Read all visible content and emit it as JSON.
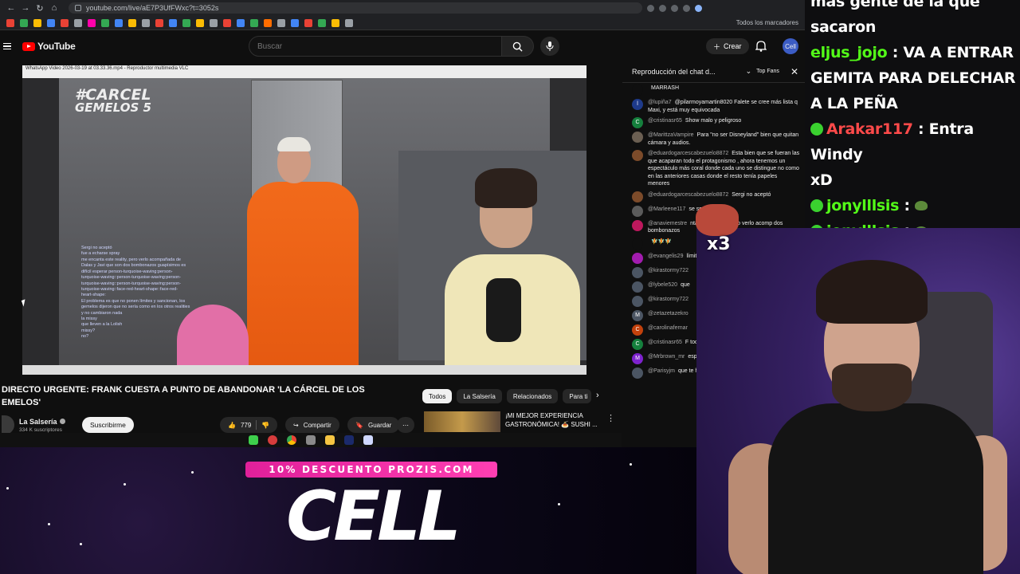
{
  "browser": {
    "url": "youtube.com/live/aE7P3UfFWxc?t=3052s",
    "bookmarks_label": "Todos los marcadores"
  },
  "header": {
    "logo_text": "YouTube",
    "search_placeholder": "Buscar",
    "create_label": "Crear",
    "avatar_text": "Cell"
  },
  "video": {
    "overlay_logo_line1": "#CARCEL",
    "overlay_logo_line2": "GEMELOS 5",
    "vlc_title": "WhatsApp Video 2026-03-19 at 03.33.36.mp4 - Reproductor multimedia VLC",
    "overlay_chat": [
      "Sergi no aceptó",
      "fue a echarse spray",
      "me encanta este reality, pero verlo acompañada de",
      "Dalas y Javi que son dos bombonazos guapísimos es",
      "difícil esperar person-turquoise-waving:person-",
      "turquoise-waving::person-turquoise-waving:person-",
      "turquoise-waving::person-turquoise-waving:person-",
      "turquoise-waving::face-red-heart-shape::face-red-",
      "heart-shape:",
      "El problema es que no ponen límites y sancionan, los",
      "gemelos dijeron que no sería como en los otros realities",
      "y no cambiaron nada",
      "la missy",
      "que lleven a la Lolish",
      "missy?",
      "no?"
    ]
  },
  "below": {
    "title": "DIRECTO URGENTE: FRANK CUESTA A PUNTO DE ABANDONAR 'LA CÁRCEL DE LOS EMELOS'",
    "channel_name": "La Salsería",
    "subscribers": "334 K suscriptores",
    "subscribe_label": "Suscribirme",
    "like_count": "779",
    "share_label": "Compartir",
    "save_label": "Guardar",
    "chips": [
      "Todos",
      "La Salsería",
      "Relacionados",
      "Para ti"
    ],
    "rec_title_line1": "¡MI MEJOR EXPERIENCIA",
    "rec_title_line2": "GASTRONÓMICA! 🍝 SUSHI ..."
  },
  "chat": {
    "header_title": "Reproducción del chat d...",
    "top_fans_label": "Top Fans",
    "messages": [
      {
        "initial": "",
        "color": "#0f0f0f",
        "user": "",
        "text": "MARRASH"
      },
      {
        "initial": "l",
        "color": "#1e3a8a",
        "user": "@lupiña7",
        "text": "@pilarmoyamartin8020 Falete se cree más lista q Maxi, y está muy equivocada"
      },
      {
        "initial": "C",
        "color": "#15803d",
        "user": "@cristinasr65",
        "text": "Show malo y peligroso"
      },
      {
        "initial": "",
        "color": "#6b5f52",
        "user": "@MarittzaVampire",
        "text": "Para \"no ser Disneyland\" bien que quitan cámara y audios."
      },
      {
        "initial": "",
        "color": "#7c4b2a",
        "user": "@eduardogarcescabezuelo8872",
        "text": "Esta bien que se fueran las que acaparan todo el protagonismo , ahora tenemos un espectáculo más coral donde cada uno se distingue no como en las anteriores casas donde el resto tenía papeles menores"
      },
      {
        "initial": "",
        "color": "#7c4b2a",
        "user": "@eduardogarcescabezuelo8872",
        "text": "Sergi no aceptó"
      },
      {
        "initial": "",
        "color": "#5b5b5b",
        "user": "@Marleene117",
        "text": "se spray"
      },
      {
        "initial": "",
        "color": "#be185d",
        "user": "@anaviemestre",
        "text": "nta este reality, pero verlo acomp dos bombonazos"
      },
      {
        "initial": "",
        "color": "#0f0f0f",
        "user": "",
        "text": "🧚🧚🧚"
      },
      {
        "initial": "",
        "color": "#a21caf",
        "user": "@evangelis29",
        "text": "límites y sanciona sería como en lo nada"
      },
      {
        "initial": "",
        "color": "#4b5563",
        "user": "@kirastormy722",
        "text": ""
      },
      {
        "initial": "",
        "color": "#4b5563",
        "user": "@lybele520",
        "text": "que"
      },
      {
        "initial": "",
        "color": "#4b5563",
        "user": "@kirastormy722",
        "text": ""
      },
      {
        "initial": "M",
        "color": "#4b5563",
        "user": "@zetazetazekro",
        "text": ""
      },
      {
        "initial": "C",
        "color": "#c2410c",
        "user": "@carolinafernar",
        "text": ""
      },
      {
        "initial": "C",
        "color": "#15803d",
        "user": "@cristinasr65",
        "text": "F todo"
      },
      {
        "initial": "M",
        "color": "#7e22ce",
        "user": "@Mrbrown_mr",
        "text": "esponsor va a ser"
      },
      {
        "initial": "",
        "color": "#4b5563",
        "user": "@Parisyjm",
        "text": "que te haces jaja"
      }
    ]
  },
  "stream_chat": {
    "line0": "más gente de la que",
    "line1": "sacaron",
    "msg1_user": "eljus_jojo",
    "msg1_text_a": " : VA A ENTRAR",
    "msg1_text_b": "GEMITA PARA DELECHAR",
    "msg1_text_c": "A LA PEÑA",
    "msg2_user": "Arakar117",
    "msg2_text_a": " : Entra Windy",
    "msg2_text_b": "xD",
    "msg3_user": "jonylllsis",
    "msg4_user": "jonylllsis",
    "sep": " : "
  },
  "emote": {
    "label": "x3"
  },
  "promo": {
    "label": "10% DESCUENTO PROZIS.COM",
    "code": "CELL"
  },
  "colors": {
    "youtube_red": "#ff0000",
    "promo_pink": "#e0209a",
    "kick_green": "#53fc18",
    "jumpsuit_orange": "#f26a1b"
  }
}
